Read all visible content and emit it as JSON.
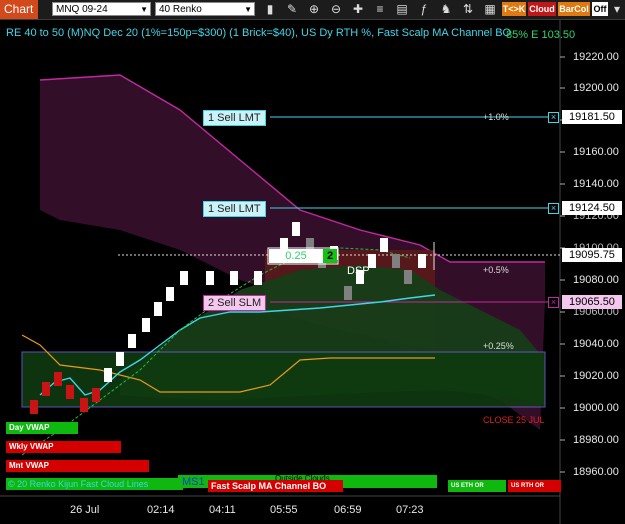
{
  "toolbar": {
    "title": "Chart",
    "instrument": "MNQ 09-24",
    "interval": "40 Renko",
    "buttons": {
      "tk": "T<>K",
      "cloud": "Cloud",
      "barcol": "BarCol",
      "off": "Off"
    },
    "icons": [
      "bar-style-icon",
      "draw-icon",
      "zoom-in-icon",
      "zoom-out-icon",
      "crosshair-icon",
      "properties-icon",
      "data-box-icon",
      "indicators-icon",
      "strategies-icon",
      "chart-trader-icon",
      "calendar-icon",
      "templates-icon",
      "scroll-icon"
    ]
  },
  "header": {
    "description": "RE 40 to 50 (M)NQ Dec 20 (1%=150p=$300) (1 Brick=$40), US Dy RTH %, Fast Scalp MA Channel BO",
    "corner_value": "85% E 103.50"
  },
  "price_axis": [
    "19220.00",
    "19200.00",
    "19180.00",
    "19160.00",
    "19140.00",
    "19120.00",
    "19100.00",
    "19080.00",
    "19060.00",
    "19040.00",
    "19020.00",
    "19000.00",
    "18980.00",
    "18960.00"
  ],
  "time_axis": [
    "26 Jul",
    "02:14",
    "04:11",
    "05:55",
    "06:59",
    "07:23"
  ],
  "orders": [
    {
      "label": "1 Sell LMT",
      "price": "19181.50"
    },
    {
      "label": "1 Sell LMT",
      "price": "19124.50"
    },
    {
      "label": "2 Sell SLM",
      "price": "19065.50"
    }
  ],
  "last_price": "19095.75",
  "position_box": {
    "qty": "0.25",
    "count": "2"
  },
  "annotations": {
    "dsp": "DSP",
    "plus_1": "+1.0%",
    "plus_05": "+0.5%",
    "plus_025": "+0.25%",
    "close": "CLOSE 25 JUL",
    "bottom_left": "© 20 Renko Kijun Fast Cloud Lines",
    "ms1": "MS1",
    "outside_clouds": "Outside Clouds"
  },
  "bands": {
    "day_vwap": "Day VWAP",
    "wkly_vwap": "Wkly VWAP",
    "mnt_vwap": "Mnt VWAP",
    "fast_scalp": "Fast Scalp MA Channel BO",
    "us_eth_or": "US ETH OR",
    "us_rth_or": "US RTH OR"
  },
  "colors": {
    "title_bg": "#d24a1c",
    "cyan": "#3fd6e8",
    "magenta_line": "#c02aa0",
    "green_band": "#0fb80f",
    "red_band": "#d40000",
    "bull_brick": "#ffffff",
    "bear_brick": "#808080",
    "down_red": "#c81414"
  }
}
